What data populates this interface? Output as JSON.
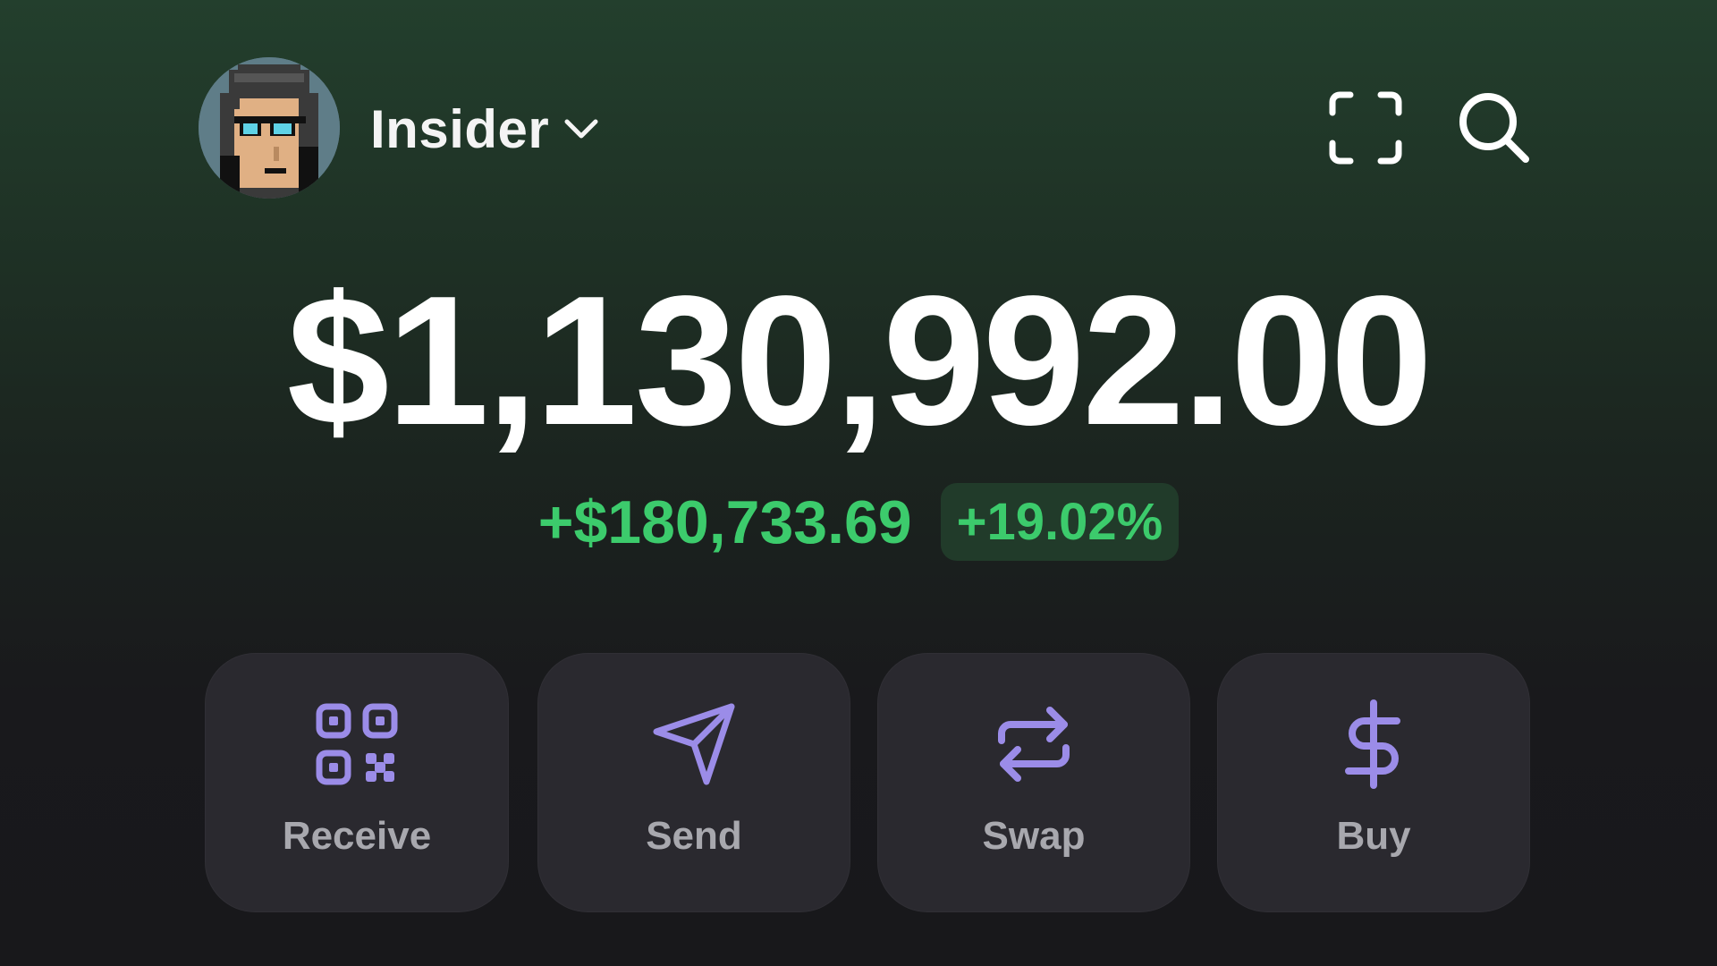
{
  "header": {
    "account_name": "Insider",
    "avatar_icon": "pixel-punk-avatar",
    "dropdown_icon": "chevron-down-icon",
    "scan_icon": "scan-icon",
    "search_icon": "search-icon"
  },
  "balance": {
    "total": "$1,130,992.00",
    "change_amount": "+$180,733.69",
    "change_percent": "+19.02%"
  },
  "actions": [
    {
      "label": "Receive",
      "icon": "qr-code-icon"
    },
    {
      "label": "Send",
      "icon": "send-icon"
    },
    {
      "label": "Swap",
      "icon": "swap-icon"
    },
    {
      "label": "Buy",
      "icon": "dollar-icon"
    }
  ],
  "colors": {
    "accent": "#9b8ce8",
    "positive": "#3ccb6c",
    "text": "#ffffff",
    "button_bg": "#2a292f"
  }
}
